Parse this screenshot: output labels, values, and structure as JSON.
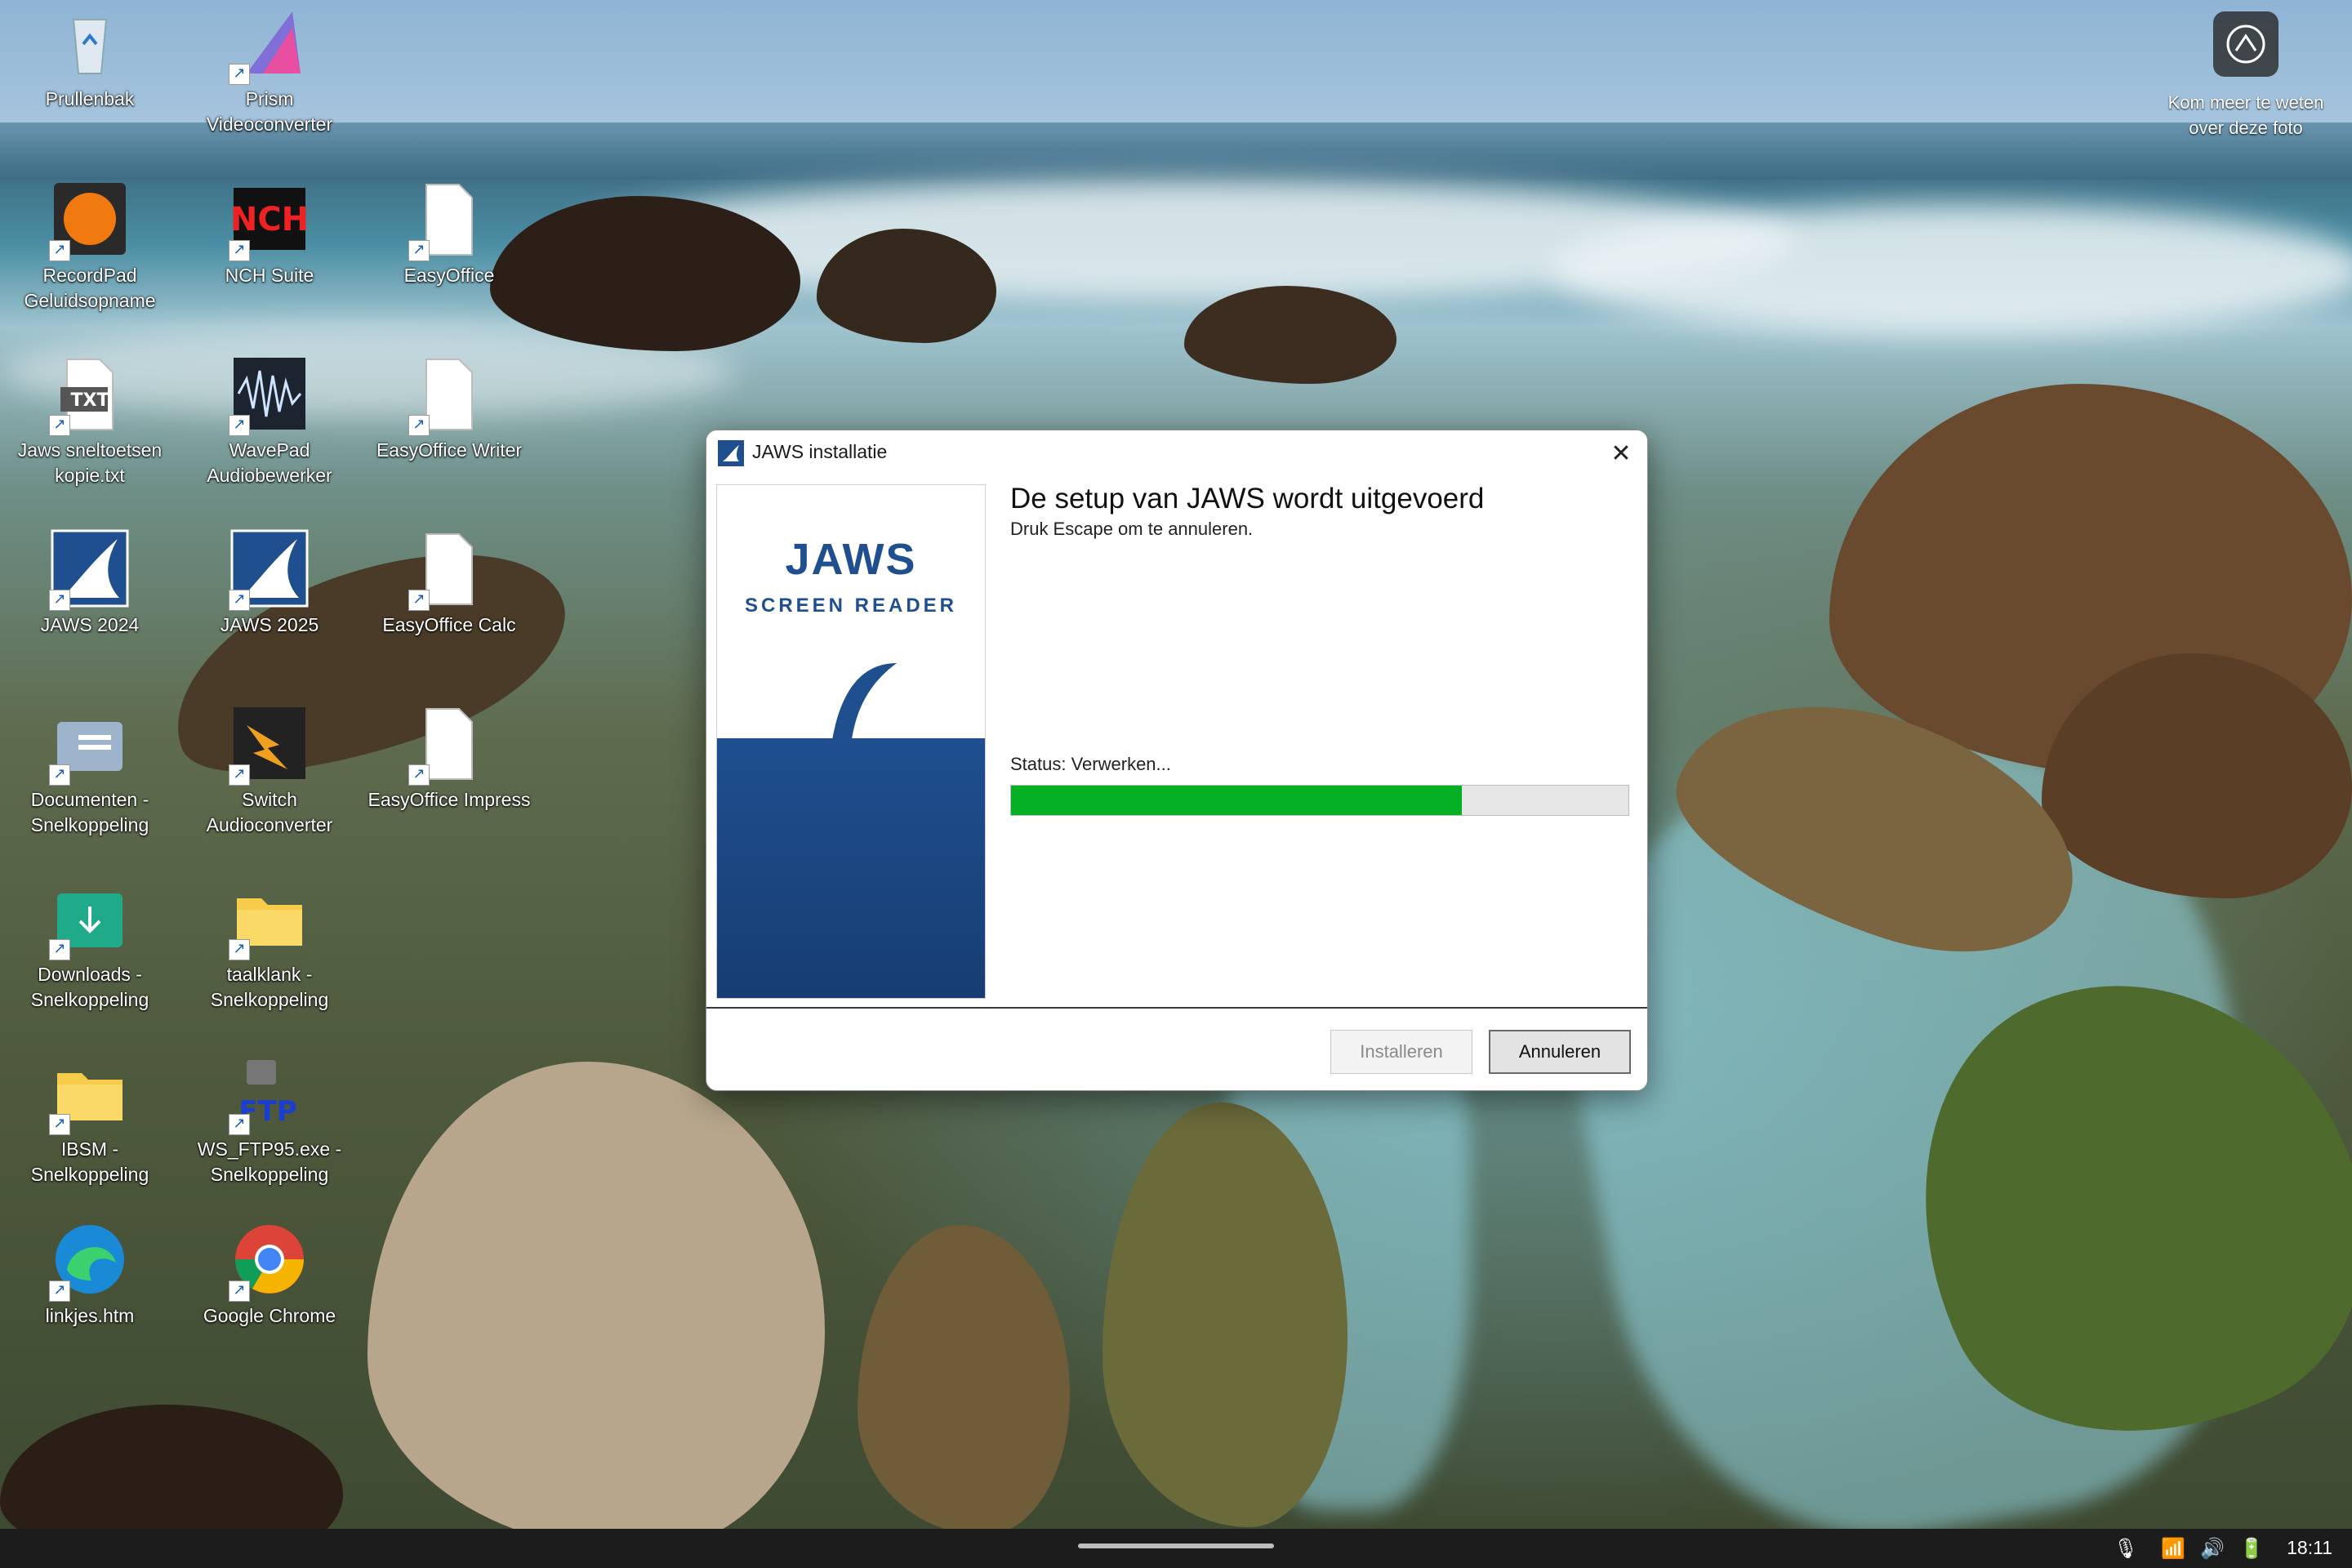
{
  "desktop": {
    "icons": [
      {
        "label": "Prullenbak",
        "icon": "recycle-bin-icon"
      },
      {
        "label": "Prism\nVideoconverter",
        "icon": "prism-icon"
      },
      {
        "label": "RecordPad\nGeluidsopname",
        "icon": "recordpad-icon"
      },
      {
        "label": "NCH Suite",
        "icon": "nch-icon"
      },
      {
        "label": "EasyOffice",
        "icon": "document-icon"
      },
      {
        "label": "Jaws sneltoetsen\nkopie.txt",
        "icon": "txt-file-icon",
        "badge": "TXT"
      },
      {
        "label": "WavePad\nAudiobewerker",
        "icon": "wavepad-icon"
      },
      {
        "label": "EasyOffice Writer",
        "icon": "document-icon"
      },
      {
        "label": "JAWS 2024",
        "icon": "jaws-icon"
      },
      {
        "label": "JAWS 2025",
        "icon": "jaws-icon"
      },
      {
        "label": "EasyOffice Calc",
        "icon": "document-icon"
      },
      {
        "label": "Documenten -\nSnelkoppeling",
        "icon": "documents-folder-icon"
      },
      {
        "label": "Switch\nAudioconverter",
        "icon": "switch-icon"
      },
      {
        "label": "EasyOffice Impress",
        "icon": "document-icon"
      },
      {
        "label": "Downloads -\nSnelkoppeling",
        "icon": "downloads-folder-icon"
      },
      {
        "label": "taalklank -\nSnelkoppeling",
        "icon": "folder-icon"
      },
      {
        "label": "IBSM -\nSnelkoppeling",
        "icon": "folder-icon"
      },
      {
        "label": "WS_FTP95.exe -\nSnelkoppeling",
        "icon": "ftp-icon",
        "badge": "FTP"
      },
      {
        "label": "linkjes.htm",
        "icon": "edge-icon"
      },
      {
        "label": "Google Chrome",
        "icon": "chrome-icon"
      }
    ],
    "photo_widget": {
      "label": "Kom meer te weten\nover deze foto",
      "icon": "camera-icon"
    }
  },
  "dialog": {
    "title": "JAWS installatie",
    "close_glyph": "✕",
    "banner_title": "JAWS",
    "banner_subtitle": "SCREEN READER",
    "heading": "De setup van JAWS wordt uitgevoerd",
    "subheading": "Druk Escape om te annuleren.",
    "status": "Status: Verwerken...",
    "progress_fraction": 0.73,
    "install_label": "Installeren",
    "cancel_label": "Annuleren",
    "colors": {
      "progress": "#06b025",
      "brand": "#1f4f8f"
    }
  },
  "taskbar": {
    "tray_icons": [
      "microphone-icon",
      "wifi-icon",
      "volume-icon",
      "battery-icon"
    ],
    "clock": "18:11"
  }
}
